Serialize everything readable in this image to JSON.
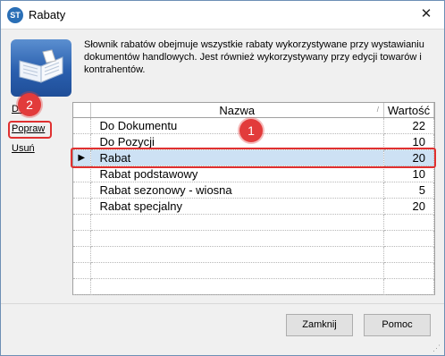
{
  "window": {
    "title": "Rabaty",
    "app_icon_text": "ST",
    "close_glyph": "✕"
  },
  "description": "Słownik rabatów obejmuje wszystkie rabaty wykorzystywane przy wystawianiu dokumentów handlowych. Jest również wykorzystywany przy edycji towarów i kontrahentów.",
  "side_links": {
    "add": "Dodaj",
    "edit": "Popraw",
    "delete": "Usuń"
  },
  "markers": {
    "one": "1",
    "two": "2"
  },
  "table": {
    "columns": {
      "name": "Nazwa",
      "value": "Wartość"
    },
    "selected_indicator": "▶",
    "rows": [
      {
        "name": "Do Dokumentu",
        "value": "22"
      },
      {
        "name": "Do Pozycji",
        "value": "10"
      },
      {
        "name": "Rabat",
        "value": "20"
      },
      {
        "name": "Rabat podstawowy",
        "value": "10"
      },
      {
        "name": "Rabat sezonowy - wiosna",
        "value": "5"
      },
      {
        "name": "Rabat specjalny",
        "value": "20"
      }
    ],
    "selected_row": 2
  },
  "buttons": {
    "close": "Zamknij",
    "help": "Pomoc"
  },
  "colors": {
    "selection": "#cde1f4",
    "highlight": "#e03030",
    "marker": "#e23b3b",
    "logo": "#2a5fae"
  }
}
